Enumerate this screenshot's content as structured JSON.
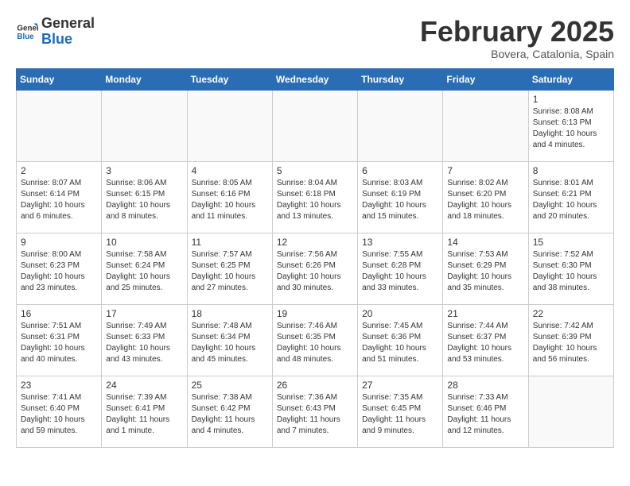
{
  "header": {
    "logo_line1": "General",
    "logo_line2": "Blue",
    "month": "February 2025",
    "location": "Bovera, Catalonia, Spain"
  },
  "weekdays": [
    "Sunday",
    "Monday",
    "Tuesday",
    "Wednesday",
    "Thursday",
    "Friday",
    "Saturday"
  ],
  "weeks": [
    [
      {
        "day": "",
        "info": ""
      },
      {
        "day": "",
        "info": ""
      },
      {
        "day": "",
        "info": ""
      },
      {
        "day": "",
        "info": ""
      },
      {
        "day": "",
        "info": ""
      },
      {
        "day": "",
        "info": ""
      },
      {
        "day": "1",
        "info": "Sunrise: 8:08 AM\nSunset: 6:13 PM\nDaylight: 10 hours\nand 4 minutes."
      }
    ],
    [
      {
        "day": "2",
        "info": "Sunrise: 8:07 AM\nSunset: 6:14 PM\nDaylight: 10 hours\nand 6 minutes."
      },
      {
        "day": "3",
        "info": "Sunrise: 8:06 AM\nSunset: 6:15 PM\nDaylight: 10 hours\nand 8 minutes."
      },
      {
        "day": "4",
        "info": "Sunrise: 8:05 AM\nSunset: 6:16 PM\nDaylight: 10 hours\nand 11 minutes."
      },
      {
        "day": "5",
        "info": "Sunrise: 8:04 AM\nSunset: 6:18 PM\nDaylight: 10 hours\nand 13 minutes."
      },
      {
        "day": "6",
        "info": "Sunrise: 8:03 AM\nSunset: 6:19 PM\nDaylight: 10 hours\nand 15 minutes."
      },
      {
        "day": "7",
        "info": "Sunrise: 8:02 AM\nSunset: 6:20 PM\nDaylight: 10 hours\nand 18 minutes."
      },
      {
        "day": "8",
        "info": "Sunrise: 8:01 AM\nSunset: 6:21 PM\nDaylight: 10 hours\nand 20 minutes."
      }
    ],
    [
      {
        "day": "9",
        "info": "Sunrise: 8:00 AM\nSunset: 6:23 PM\nDaylight: 10 hours\nand 23 minutes."
      },
      {
        "day": "10",
        "info": "Sunrise: 7:58 AM\nSunset: 6:24 PM\nDaylight: 10 hours\nand 25 minutes."
      },
      {
        "day": "11",
        "info": "Sunrise: 7:57 AM\nSunset: 6:25 PM\nDaylight: 10 hours\nand 27 minutes."
      },
      {
        "day": "12",
        "info": "Sunrise: 7:56 AM\nSunset: 6:26 PM\nDaylight: 10 hours\nand 30 minutes."
      },
      {
        "day": "13",
        "info": "Sunrise: 7:55 AM\nSunset: 6:28 PM\nDaylight: 10 hours\nand 33 minutes."
      },
      {
        "day": "14",
        "info": "Sunrise: 7:53 AM\nSunset: 6:29 PM\nDaylight: 10 hours\nand 35 minutes."
      },
      {
        "day": "15",
        "info": "Sunrise: 7:52 AM\nSunset: 6:30 PM\nDaylight: 10 hours\nand 38 minutes."
      }
    ],
    [
      {
        "day": "16",
        "info": "Sunrise: 7:51 AM\nSunset: 6:31 PM\nDaylight: 10 hours\nand 40 minutes."
      },
      {
        "day": "17",
        "info": "Sunrise: 7:49 AM\nSunset: 6:33 PM\nDaylight: 10 hours\nand 43 minutes."
      },
      {
        "day": "18",
        "info": "Sunrise: 7:48 AM\nSunset: 6:34 PM\nDaylight: 10 hours\nand 45 minutes."
      },
      {
        "day": "19",
        "info": "Sunrise: 7:46 AM\nSunset: 6:35 PM\nDaylight: 10 hours\nand 48 minutes."
      },
      {
        "day": "20",
        "info": "Sunrise: 7:45 AM\nSunset: 6:36 PM\nDaylight: 10 hours\nand 51 minutes."
      },
      {
        "day": "21",
        "info": "Sunrise: 7:44 AM\nSunset: 6:37 PM\nDaylight: 10 hours\nand 53 minutes."
      },
      {
        "day": "22",
        "info": "Sunrise: 7:42 AM\nSunset: 6:39 PM\nDaylight: 10 hours\nand 56 minutes."
      }
    ],
    [
      {
        "day": "23",
        "info": "Sunrise: 7:41 AM\nSunset: 6:40 PM\nDaylight: 10 hours\nand 59 minutes."
      },
      {
        "day": "24",
        "info": "Sunrise: 7:39 AM\nSunset: 6:41 PM\nDaylight: 11 hours\nand 1 minute."
      },
      {
        "day": "25",
        "info": "Sunrise: 7:38 AM\nSunset: 6:42 PM\nDaylight: 11 hours\nand 4 minutes."
      },
      {
        "day": "26",
        "info": "Sunrise: 7:36 AM\nSunset: 6:43 PM\nDaylight: 11 hours\nand 7 minutes."
      },
      {
        "day": "27",
        "info": "Sunrise: 7:35 AM\nSunset: 6:45 PM\nDaylight: 11 hours\nand 9 minutes."
      },
      {
        "day": "28",
        "info": "Sunrise: 7:33 AM\nSunset: 6:46 PM\nDaylight: 11 hours\nand 12 minutes."
      },
      {
        "day": "",
        "info": ""
      }
    ]
  ]
}
